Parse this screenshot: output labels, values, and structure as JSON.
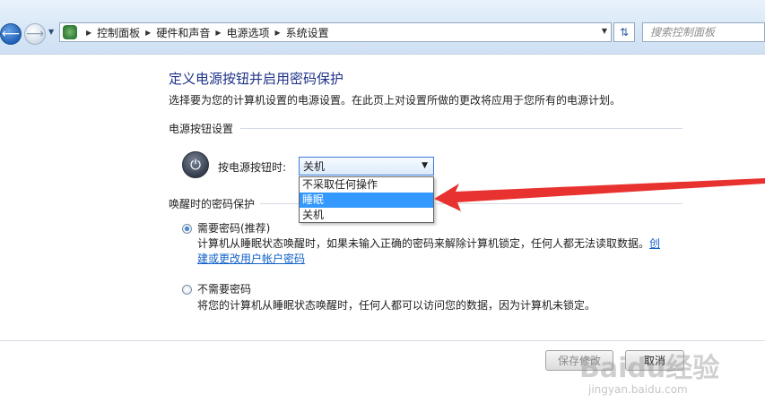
{
  "address": {
    "breadcrumbs": [
      "控制面板",
      "硬件和声音",
      "电源选项",
      "系统设置"
    ]
  },
  "search": {
    "placeholder": "搜索控制面板"
  },
  "page": {
    "title": "定义电源按钮并启用密码保护",
    "description": "选择要为您的计算机设置的电源设置。在此页上对设置所做的更改将应用于您所有的电源计划。"
  },
  "power_section": {
    "heading": "电源按钮设置",
    "label": "按电源按钮时:",
    "selected": "关机",
    "options": [
      "不采取任何操作",
      "睡眠",
      "关机"
    ],
    "highlighted_option": "睡眠"
  },
  "wake_section": {
    "heading": "唤醒时的密码保护",
    "require": {
      "label": "需要密码(推荐)",
      "checked": true,
      "desc": "计算机从睡眠状态唤醒时，如果未输入正确的密码来解除计算机锁定，任何人都无法读取数据。",
      "link": "创建或更改用户帐户密码"
    },
    "no_require": {
      "label": "不需要密码",
      "checked": false,
      "desc": "将您的计算机从睡眠状态唤醒时，任何人都可以访问您的数据，因为计算机未锁定。"
    }
  },
  "footer": {
    "save_label": "保存修改",
    "cancel_label": "取消"
  },
  "watermark": {
    "logo": "Baidu经验",
    "url": "jingyan.baidu.com"
  },
  "colors": {
    "title": "#1e3287",
    "link": "#1160c9",
    "selection": "#3399ff",
    "arrow": "#e8322f"
  },
  "icons": {
    "back": "back-arrow-icon",
    "forward": "forward-arrow-icon",
    "refresh": "refresh-icon",
    "power": "power-icon",
    "control_panel": "control-panel-icon"
  }
}
